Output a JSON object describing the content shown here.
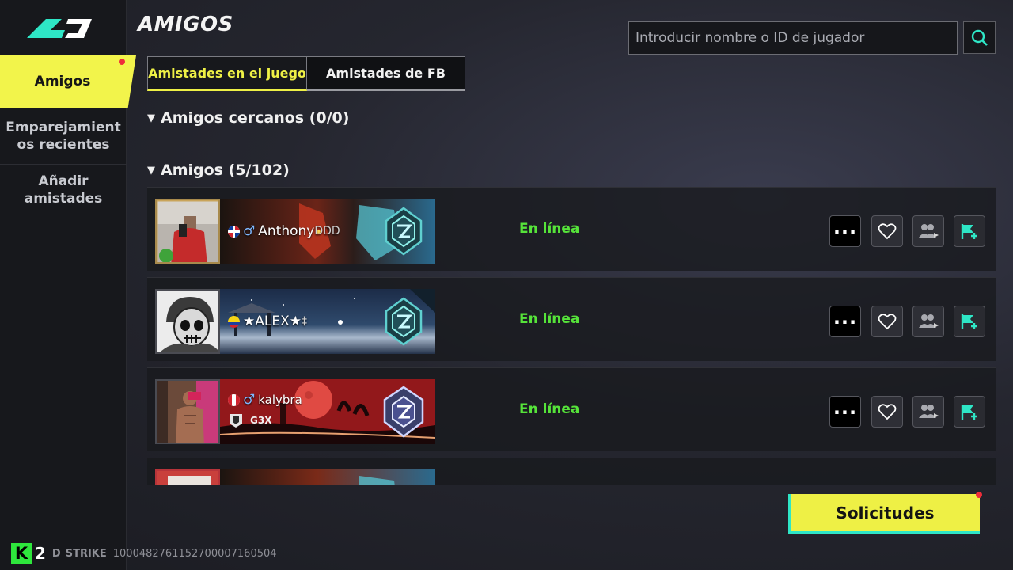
{
  "page": {
    "title": "AMIGOS"
  },
  "sidebar": {
    "items": [
      {
        "label": "Amigos",
        "active": true,
        "notification": true
      },
      {
        "label": "Emparejamient os recientes",
        "line1": "Emparejamient",
        "line2": "os recientes"
      },
      {
        "label": "Añadir amistades",
        "line1": "Añadir",
        "line2": "amistades"
      }
    ]
  },
  "search": {
    "placeholder": "Introducir nombre o ID de jugador",
    "value": ""
  },
  "tabs": [
    {
      "label": "Amistades en el juego",
      "active": true
    },
    {
      "label": "Amistades de FB",
      "active": false
    }
  ],
  "sections": {
    "nearby": {
      "label": "Amigos cercanos (0/0)",
      "expanded": true
    },
    "friends": {
      "label": "Amigos (5/102)",
      "expanded": true
    }
  },
  "friends": [
    {
      "name": "Anthony",
      "name_suffix": "DDD",
      "country": "Dominican Republic",
      "gender": "♂",
      "status": "En línea"
    },
    {
      "name": "★ALEX★",
      "name_suffix": "‡",
      "country": "Colombia",
      "gender": "",
      "status": "En línea"
    },
    {
      "name": "kalybra",
      "name_suffix": "",
      "country": "Peru",
      "gender": "♂",
      "guild_tag": "G3X",
      "status": "En línea"
    }
  ],
  "actions": {
    "more": "more-icon",
    "like": "heart-icon",
    "invite": "invite-group-icon",
    "flag": "flag-add-icon"
  },
  "requests_button": {
    "label": "Solicitudes",
    "notification": true
  },
  "footer": {
    "logo": "K",
    "logo_suffix": "2",
    "game": "STRIKE",
    "prefix": "D",
    "id": "100048276115270000716050​4",
    "id_display": "10004827611527000071605​04"
  },
  "colors": {
    "accent": "#eef046",
    "online": "#56e33a",
    "teal": "#2ee6c6",
    "notification": "#ef2d3a"
  }
}
